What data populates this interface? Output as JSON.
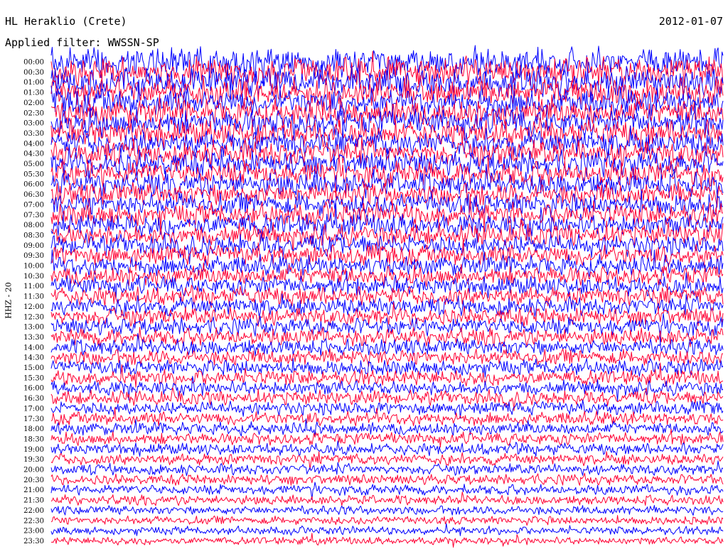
{
  "header": {
    "title": "HL Heraklio (Crete)",
    "date": "2012-01-07",
    "filter": "Applied filter: WWSSN-SP"
  },
  "colors": {
    "trace_a": "#0000ff",
    "trace_b": "#ff0033",
    "background": "#ffffff",
    "text": "#000000"
  },
  "chart_data": {
    "type": "line",
    "ylabel": "HHZ - 20",
    "row_labels": [
      "00:00",
      "00:30",
      "01:00",
      "01:30",
      "02:00",
      "02:30",
      "03:00",
      "03:30",
      "04:00",
      "04:30",
      "05:00",
      "05:30",
      "06:00",
      "06:30",
      "07:00",
      "07:30",
      "08:00",
      "08:30",
      "09:00",
      "09:30",
      "10:00",
      "10:30",
      "11:00",
      "11:30",
      "12:00",
      "12:30",
      "13:00",
      "13:30",
      "14:00",
      "14:30",
      "15:00",
      "15:30",
      "16:00",
      "16:30",
      "17:00",
      "17:30",
      "18:00",
      "18:30",
      "19:00",
      "19:30",
      "20:00",
      "20:30",
      "21:00",
      "21:30",
      "22:00",
      "22:30",
      "23:00",
      "23:30"
    ],
    "series_color_pattern": [
      "blue",
      "red"
    ],
    "grid": false,
    "legend": "none"
  }
}
